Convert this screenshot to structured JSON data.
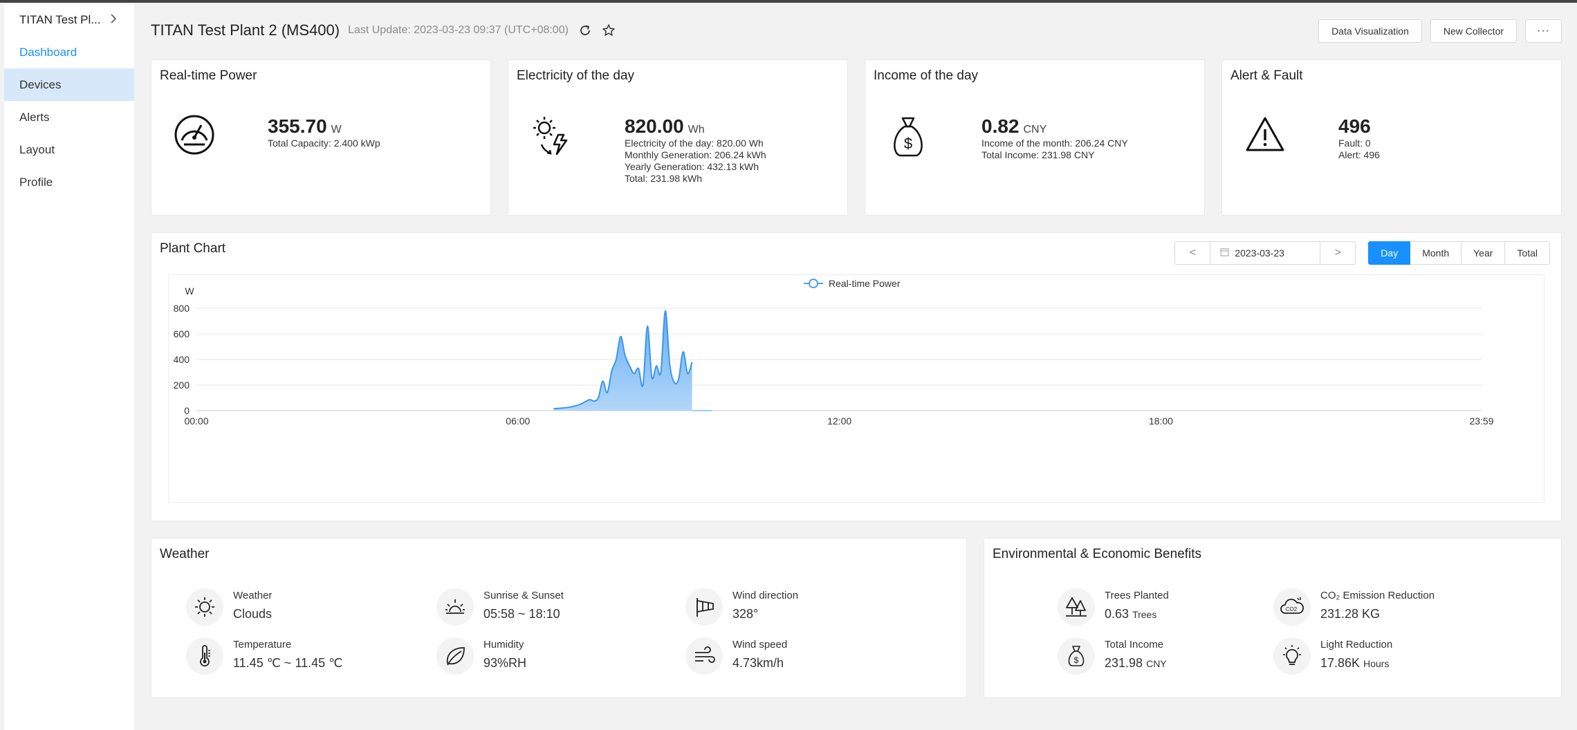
{
  "sidebar": {
    "plant_name": "TITAN Test Pl...",
    "items": [
      {
        "label": "Dashboard"
      },
      {
        "label": "Devices"
      },
      {
        "label": "Alerts"
      },
      {
        "label": "Layout"
      },
      {
        "label": "Profile"
      }
    ]
  },
  "header": {
    "title": "TITAN Test Plant 2 (MS400)",
    "last_update": "Last Update: 2023-03-23 09:37 (UTC+08:00)",
    "buttons": {
      "data_visualization": "Data Visualization",
      "new_collector": "New Collector",
      "more": "···"
    }
  },
  "kpis": {
    "realtime_power": {
      "title": "Real-time Power",
      "value": "355.70",
      "unit": "W",
      "sub1": "Total Capacity: 2.400 kWp"
    },
    "electricity": {
      "title": "Electricity of the day",
      "value": "820.00",
      "unit": "Wh",
      "sub1": "Electricity of the day: 820.00 Wh",
      "sub2": "Monthly Generation: 206.24 kWh",
      "sub3": "Yearly Generation: 432.13 kWh",
      "sub4": "Total: 231.98 kWh"
    },
    "income": {
      "title": "Income of the day",
      "value": "0.82",
      "unit": "CNY",
      "sub1": "Income of the month: 206.24 CNY",
      "sub2": "Total Income: 231.98 CNY"
    },
    "alert": {
      "title": "Alert & Fault",
      "value": "496",
      "sub1": "Fault: 0",
      "sub2": "Alert: 496"
    }
  },
  "plant_chart": {
    "title": "Plant Chart",
    "date": "2023-03-23",
    "prev": "<",
    "next": ">",
    "periods": [
      "Day",
      "Month",
      "Year",
      "Total"
    ],
    "active_period": "Day"
  },
  "chart_data": {
    "type": "area",
    "title": "",
    "legend": [
      "Real-time Power"
    ],
    "legend_placement": "top-center",
    "ylabel": "W",
    "xlabel": "",
    "ylim": [
      0,
      800
    ],
    "y_ticks": [
      0,
      200,
      400,
      600,
      800
    ],
    "x_ticks": [
      "00:00",
      "06:00",
      "12:00",
      "18:00",
      "23:59"
    ],
    "grid": true,
    "color": "#4fa3f0",
    "series": [
      {
        "name": "Real-time Power",
        "x": [
          "06:40",
          "06:50",
          "07:00",
          "07:10",
          "07:20",
          "07:25",
          "07:30",
          "07:35",
          "07:40",
          "07:45",
          "07:50",
          "07:55",
          "08:00",
          "08:05",
          "08:10",
          "08:15",
          "08:20",
          "08:25",
          "08:30",
          "08:35",
          "08:40",
          "08:45",
          "08:50",
          "08:55",
          "09:00",
          "09:05",
          "09:10",
          "09:15",
          "09:20",
          "09:25",
          "09:30",
          "09:37"
        ],
        "y": [
          15,
          20,
          30,
          50,
          85,
          75,
          100,
          230,
          140,
          310,
          400,
          580,
          430,
          350,
          290,
          330,
          200,
          660,
          260,
          350,
          300,
          780,
          360,
          220,
          250,
          460,
          290,
          380,
          0,
          0,
          0,
          0
        ]
      }
    ]
  },
  "weather": {
    "title": "Weather",
    "items": [
      {
        "label": "Weather",
        "value": "Clouds"
      },
      {
        "label": "Sunrise & Sunset",
        "value": "05:58 ~ 18:10"
      },
      {
        "label": "Wind direction",
        "value": "328°"
      },
      {
        "label": "Temperature",
        "value": "11.45 ℃ ~ 11.45 ℃"
      },
      {
        "label": "Humidity",
        "value": "93%RH"
      },
      {
        "label": "Wind speed",
        "value": "4.73km/h"
      }
    ]
  },
  "benefits": {
    "title": "Environmental & Economic Benefits",
    "items": [
      {
        "label": "Trees Planted",
        "value": "0.63",
        "unit": "Trees"
      },
      {
        "label": "CO₂ Emission Reduction",
        "value": "231.28 KG",
        "unit": ""
      },
      {
        "label": "Total Income",
        "value": "231.98",
        "unit": "CNY"
      },
      {
        "label": "Light Reduction",
        "value": "17.86K",
        "unit": "Hours"
      }
    ]
  }
}
